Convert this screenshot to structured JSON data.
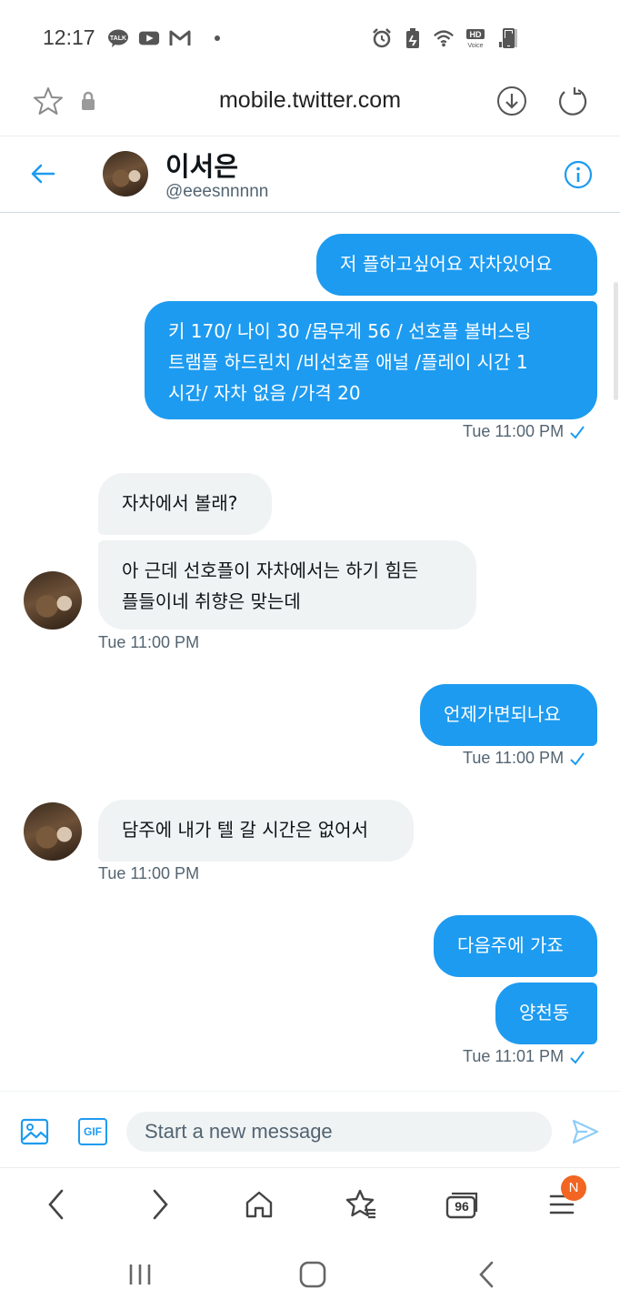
{
  "status_bar": {
    "time": "12:17",
    "left_icons": [
      "kakaotalk-icon",
      "youtube-icon",
      "gmail-icon",
      "notification-dot"
    ],
    "right_icons": [
      "alarm-icon",
      "battery-saver-icon",
      "wifi-icon",
      "hd-voice-icon",
      "signal-icon",
      "battery-icon"
    ],
    "hd_label": "HD",
    "voice_label": "Voice",
    "talk_label": "TALK"
  },
  "browser": {
    "url": "mobile.twitter.com",
    "tabs_count": "96",
    "menu_badge": "N"
  },
  "conversation": {
    "name": "이서은",
    "handle": "@eeesnnnnn"
  },
  "messages": {
    "m1": "저 플하고싶어요 자차있어요",
    "m2": [
      "키 170/ 나이 30 /몸무게 56 / 선호플 볼버스팅",
      "트램플 하드린치 /비선호플 애널 /플레이 시간 1",
      "시간/ 자차 없음 /가격 20"
    ],
    "t1": "Tue 11:00 PM",
    "m3": "자차에서 볼래?",
    "m4": [
      "아 근데 선호플이 자차에서는 하기 힘든",
      "플들이네 취향은 맞는데"
    ],
    "t2": "Tue 11:00 PM",
    "m5": "언제가면되나요",
    "t3": "Tue 11:00 PM",
    "m6": "담주에 내가 텔 갈 시간은 없어서",
    "t4": "Tue 11:00 PM",
    "m7": "다음주에 가죠",
    "m8": "양천동",
    "t5": "Tue 11:01 PM"
  },
  "composer": {
    "placeholder": "Start a new message",
    "gif_label": "GIF"
  },
  "colors": {
    "accent": "#1d9bf0",
    "received_bubble": "#eff3f4",
    "badge": "#f26522"
  }
}
